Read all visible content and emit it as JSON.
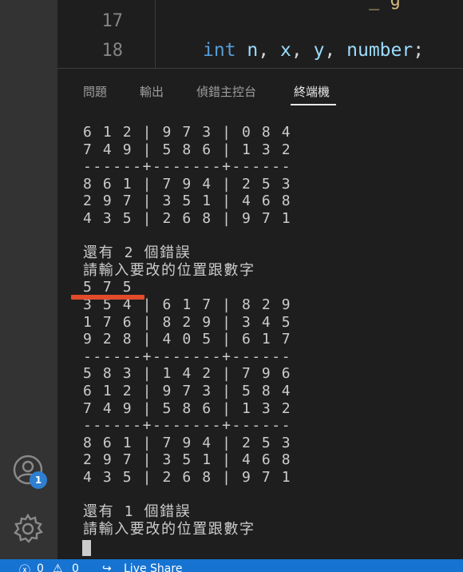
{
  "editor": {
    "line_numbers": [
      "17",
      "18"
    ],
    "code_line_18": {
      "keyword": "int",
      "vars": [
        "n",
        "x",
        "y",
        "number"
      ],
      "sep": ",",
      "end": ";"
    },
    "partial_top_text": "_ g"
  },
  "panel": {
    "tabs": [
      {
        "label": "問題",
        "active": false
      },
      {
        "label": "輸出",
        "active": false
      },
      {
        "label": "偵錯主控台",
        "active": false
      },
      {
        "label": "終端機",
        "active": true
      }
    ]
  },
  "terminal": {
    "lines": [
      "6 1 2 | 9 7 3 | 0 8 4",
      "7 4 9 | 5 8 6 | 1 3 2",
      "------+-------+------",
      "8 6 1 | 7 9 4 | 2 5 3",
      "2 9 7 | 3 5 1 | 4 6 8",
      "4 3 5 | 2 6 8 | 9 7 1",
      "",
      "還有 2 個錯誤",
      "請輸入要改的位置跟數字",
      "5 7 5",
      "3 5 4 | 6 1 7 | 8 2 9",
      "1 7 6 | 8 2 9 | 3 4 5",
      "9 2 8 | 4 0 5 | 6 1 7",
      "------+-------+------",
      "5 8 3 | 1 4 2 | 7 9 6",
      "6 1 2 | 9 7 3 | 5 8 4",
      "7 4 9 | 5 8 6 | 1 3 2",
      "------+-------+------",
      "8 6 1 | 7 9 4 | 2 5 3",
      "2 9 7 | 3 5 1 | 4 6 8",
      "4 3 5 | 2 6 8 | 9 7 1",
      "",
      "還有 1 個錯誤",
      "請輸入要改的位置跟數字"
    ]
  },
  "activity_bar": {
    "accounts_badge": "1",
    "icons": [
      "account-icon",
      "gear-icon"
    ]
  },
  "status_bar": {
    "errors": "0",
    "warnings": "0",
    "live_share": "Live Share"
  },
  "colors": {
    "background": "#1e1e1e",
    "activity_bar": "#333333",
    "status_bar": "#1773d1",
    "annotation_red": "#e24a2a",
    "keyword": "#569cd6",
    "variable": "#9cdcfe"
  }
}
